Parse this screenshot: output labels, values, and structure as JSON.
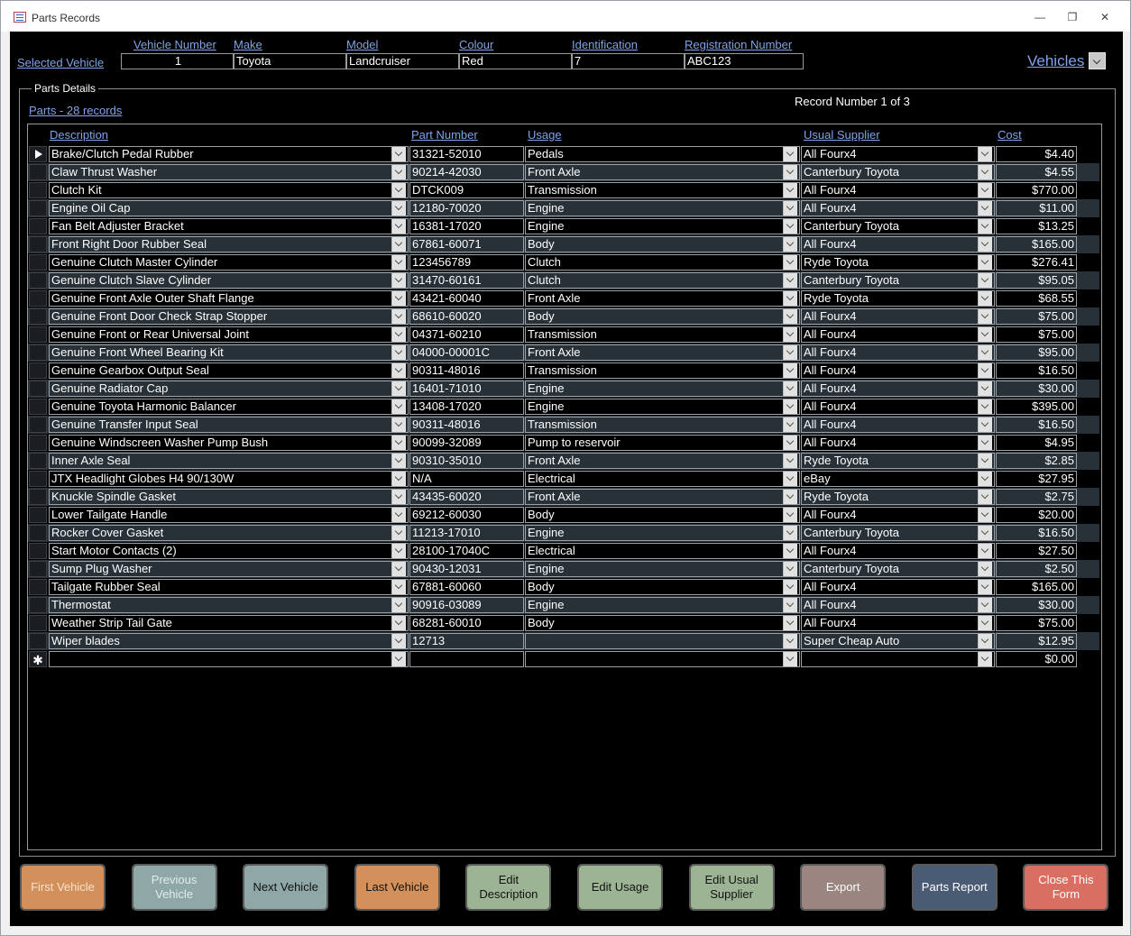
{
  "window": {
    "title": "Parts Records"
  },
  "header": {
    "selected_vehicle_label": "Selected Vehicle",
    "columns": [
      "Vehicle Number",
      "Make",
      "Model",
      "Colour",
      "Identification",
      "Registration Number"
    ],
    "values": [
      "1",
      "Toyota",
      "Landcruiser",
      "Red",
      "7",
      "ABC123"
    ],
    "vehicles_label": "Vehicles"
  },
  "parts": {
    "legend": "Parts Details",
    "record_number": "Record Number 1 of 3",
    "count_label": "Parts - 28 records",
    "columns": [
      "Description",
      "Part Number",
      "Usage",
      "Usual Supplier",
      "Cost"
    ],
    "rows": [
      [
        "Brake/Clutch Pedal Rubber",
        "31321-52010",
        "Pedals",
        "All Fourx4",
        "$4.40"
      ],
      [
        "Claw Thrust Washer",
        "90214-42030",
        "Front Axle",
        "Canterbury Toyota",
        "$4.55"
      ],
      [
        "Clutch Kit",
        "DTCK009",
        "Transmission",
        "All Fourx4",
        "$770.00"
      ],
      [
        "Engine Oil Cap",
        "12180-70020",
        "Engine",
        "All Fourx4",
        "$11.00"
      ],
      [
        "Fan Belt Adjuster Bracket",
        "16381-17020",
        "Engine",
        "Canterbury Toyota",
        "$13.25"
      ],
      [
        "Front Right Door Rubber Seal",
        "67861-60071",
        "Body",
        "All Fourx4",
        "$165.00"
      ],
      [
        "Genuine Clutch Master Cylinder",
        "123456789",
        "Clutch",
        "Ryde Toyota",
        "$276.41"
      ],
      [
        "Genuine Clutch Slave Cylinder",
        "31470-60161",
        "Clutch",
        "Canterbury Toyota",
        "$95.05"
      ],
      [
        "Genuine Front Axle Outer Shaft Flange",
        "43421-60040",
        "Front Axle",
        "Ryde Toyota",
        "$68.55"
      ],
      [
        "Genuine Front Door Check Strap Stopper",
        "68610-60020",
        "Body",
        "All Fourx4",
        "$75.00"
      ],
      [
        "Genuine Front or Rear Universal Joint",
        "04371-60210",
        "Transmission",
        "All Fourx4",
        "$75.00"
      ],
      [
        "Genuine Front Wheel Bearing Kit",
        "04000-00001C",
        "Front Axle",
        "All Fourx4",
        "$95.00"
      ],
      [
        "Genuine Gearbox Output Seal",
        "90311-48016",
        "Transmission",
        "All Fourx4",
        "$16.50"
      ],
      [
        "Genuine Radiator Cap",
        "16401-71010",
        "Engine",
        "All Fourx4",
        "$30.00"
      ],
      [
        "Genuine Toyota Harmonic Balancer",
        "13408-17020",
        "Engine",
        "All Fourx4",
        "$395.00"
      ],
      [
        "Genuine Transfer Input Seal",
        "90311-48016",
        "Transmission",
        "All Fourx4",
        "$16.50"
      ],
      [
        "Genuine Windscreen Washer Pump Bush",
        "90099-32089",
        "Pump to reservoir",
        "All Fourx4",
        "$4.95"
      ],
      [
        "Inner Axle Seal",
        "90310-35010",
        "Front Axle",
        "Ryde Toyota",
        "$2.85"
      ],
      [
        "JTX Headlight Globes H4 90/130W",
        "N/A",
        "Electrical",
        "eBay",
        "$27.95"
      ],
      [
        "Knuckle Spindle Gasket",
        "43435-60020",
        "Front Axle",
        "Ryde Toyota",
        "$2.75"
      ],
      [
        "Lower Tailgate Handle",
        "69212-60030",
        "Body",
        "All Fourx4",
        "$20.00"
      ],
      [
        "Rocker Cover Gasket",
        "11213-17010",
        "Engine",
        "Canterbury Toyota",
        "$16.50"
      ],
      [
        "Start Motor Contacts (2)",
        "28100-17040C",
        "Electrical",
        "All Fourx4",
        "$27.50"
      ],
      [
        "Sump Plug Washer",
        "90430-12031",
        "Engine",
        "Canterbury Toyota",
        "$2.50"
      ],
      [
        "Tailgate Rubber Seal",
        "67881-60060",
        "Body",
        "All Fourx4",
        "$165.00"
      ],
      [
        "Thermostat",
        "90916-03089",
        "Engine",
        "All Fourx4",
        "$30.00"
      ],
      [
        "Weather Strip Tail Gate",
        "68281-60010",
        "Body",
        "All Fourx4",
        "$75.00"
      ],
      [
        "Wiper blades",
        "12713",
        "",
        "Super Cheap Auto",
        "$12.95"
      ]
    ],
    "new_row_cost": "$0.00"
  },
  "buttons": [
    {
      "label": "First Vehicle",
      "bg": "#d4905a",
      "fg": "#f6e2cf"
    },
    {
      "label": "Previous\nVehicle",
      "bg": "#8fa7a7",
      "fg": "#e2ecec"
    },
    {
      "label": "Next Vehicle",
      "bg": "#8fa7a7",
      "fg": "#111111"
    },
    {
      "label": "Last Vehicle",
      "bg": "#d4905a",
      "fg": "#111111"
    },
    {
      "label": "Edit\nDescription",
      "bg": "#9cb494",
      "fg": "#111111"
    },
    {
      "label": "Edit Usage",
      "bg": "#9cb494",
      "fg": "#111111"
    },
    {
      "label": "Edit Usual\nSupplier",
      "bg": "#9cb494",
      "fg": "#111111"
    },
    {
      "label": "Export",
      "bg": "#9a8580",
      "fg": "#ffffff"
    },
    {
      "label": "Parts Report",
      "bg": "#4a5c74",
      "fg": "#ffffff"
    },
    {
      "label": "Close This\nForm",
      "bg": "#d96f63",
      "fg": "#ffffff"
    }
  ],
  "colors": {
    "row_even": "#000000",
    "row_odd": "#283038",
    "link": "#7fa3e8"
  }
}
